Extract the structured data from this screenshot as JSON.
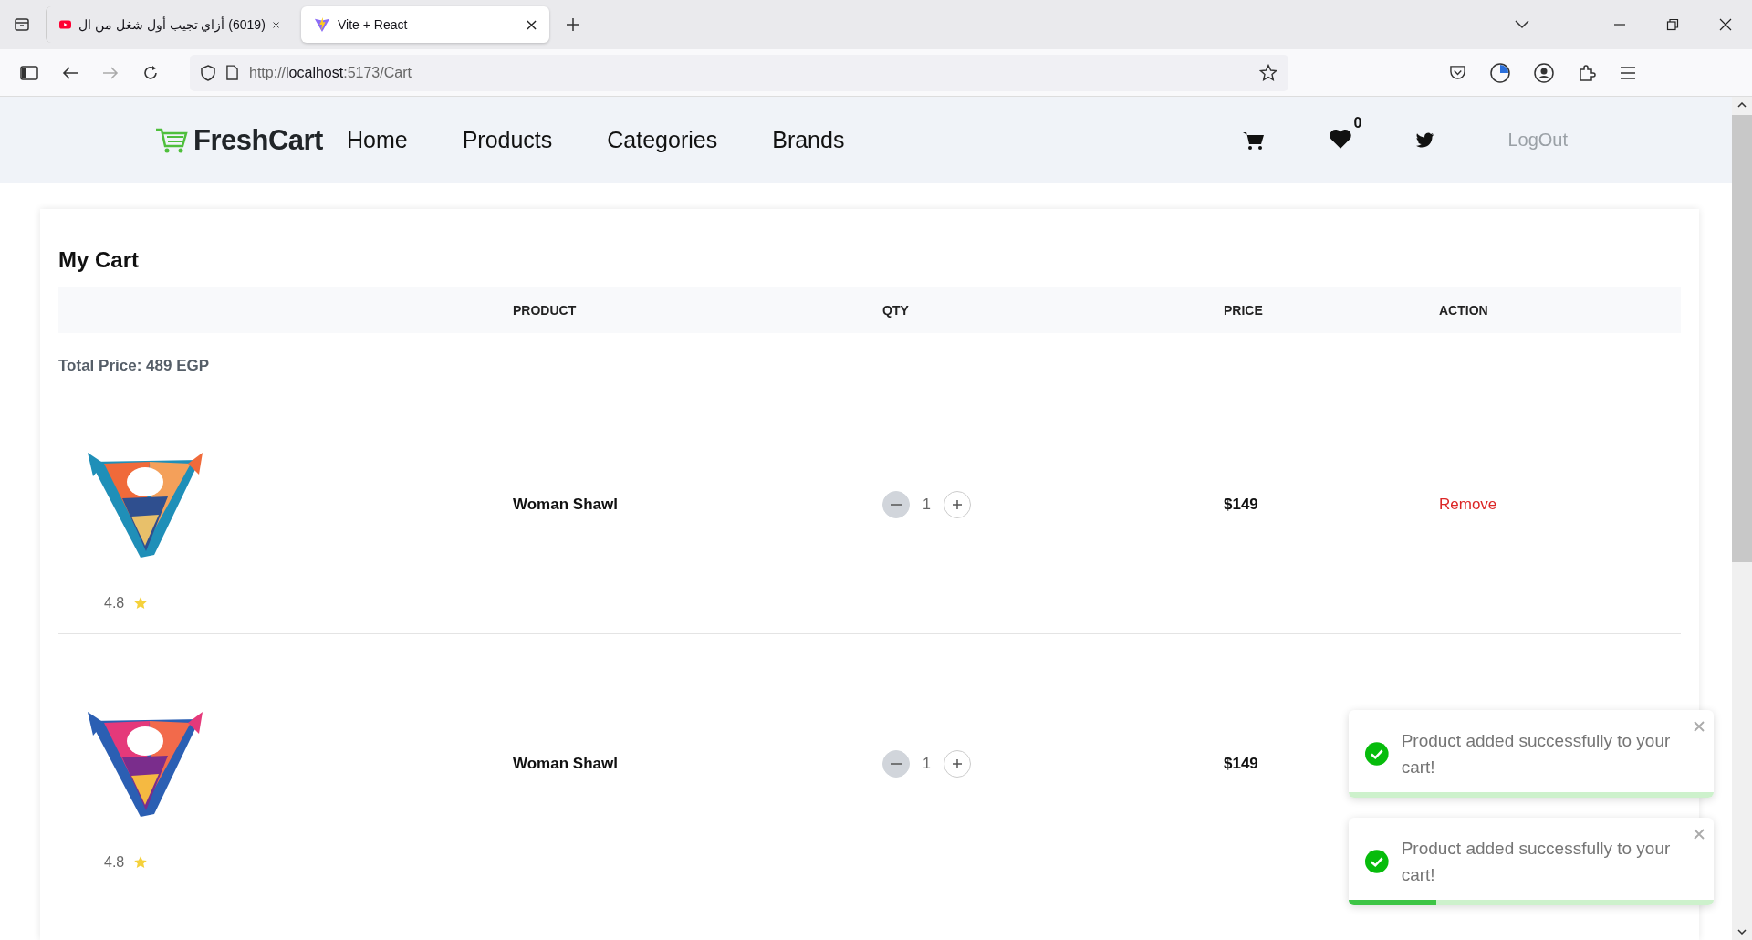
{
  "browser": {
    "tabs": [
      {
        "title": "(6019) أزاي تجيب أول شغل من ال",
        "selected": false,
        "kind": "video"
      },
      {
        "title": "Vite + React",
        "selected": true,
        "kind": "vite"
      }
    ],
    "address": {
      "scheme": "http://",
      "host": "localhost",
      "rest": ":5173/Cart"
    }
  },
  "nav": {
    "brand": "FreshCart",
    "links": [
      "Home",
      "Products",
      "Categories",
      "Brands"
    ],
    "wishlist_count": "0",
    "logout": "LogOut"
  },
  "cart": {
    "title": "My Cart",
    "columns": [
      "PRODUCT",
      "QTY",
      "PRICE",
      "ACTION"
    ],
    "total": "Total Price: 489 EGP",
    "rows": [
      {
        "name": "Woman Shawl",
        "qty": "1",
        "price": "$149",
        "action": "Remove",
        "rating": "4.8",
        "kind": "picture"
      },
      {
        "name": "Woman Shawl",
        "qty": "1",
        "price": "$149",
        "rating": "4.8",
        "kind": "picture"
      }
    ]
  },
  "toasts": [
    {
      "message": "Product added successfully to your cart!",
      "level": 0
    },
    {
      "message": "Product added successfully to your cart!",
      "level": 0.24
    }
  ]
}
